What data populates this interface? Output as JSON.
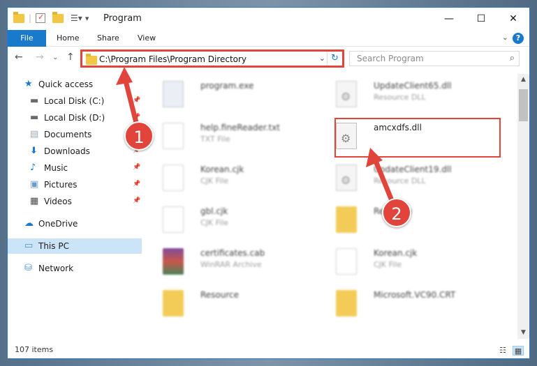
{
  "window": {
    "title": "Program",
    "controls": {
      "minimize": "—",
      "maximize": "☐",
      "close": "✕"
    }
  },
  "ribbon": {
    "tabs": [
      "File",
      "Home",
      "Share",
      "View"
    ],
    "help": "?"
  },
  "nav": {
    "address": "C:\\Program Files\\Program Directory",
    "search_placeholder": "Search Program"
  },
  "sidebar": {
    "items": [
      {
        "label": "Quick access",
        "icon": "star-icon",
        "color": "#1979ca",
        "pinned": false
      },
      {
        "label": "Local Disk (C:)",
        "icon": "drive-icon",
        "color": "#6b6b6b",
        "pinned": true
      },
      {
        "label": "Local Disk (D:)",
        "icon": "drive-icon",
        "color": "#6b6b6b",
        "pinned": true
      },
      {
        "label": "Documents",
        "icon": "documents-icon",
        "color": "#9aa8b6",
        "pinned": true
      },
      {
        "label": "Downloads",
        "icon": "download-icon",
        "color": "#1979ca",
        "pinned": true
      },
      {
        "label": "Music",
        "icon": "music-icon",
        "color": "#1979ca",
        "pinned": true
      },
      {
        "label": "Pictures",
        "icon": "pictures-icon",
        "color": "#6b9bc8",
        "pinned": true
      },
      {
        "label": "Videos",
        "icon": "videos-icon",
        "color": "#4a4a4a",
        "pinned": true
      },
      {
        "label": "OneDrive",
        "icon": "cloud-icon",
        "color": "#1979ca",
        "pinned": false
      },
      {
        "label": "This PC",
        "icon": "computer-icon",
        "color": "#4a90d9",
        "pinned": false,
        "selected": true
      },
      {
        "label": "Network",
        "icon": "network-icon",
        "color": "#4a90d9",
        "pinned": false
      }
    ]
  },
  "files": [
    {
      "name": "program.exe",
      "type": "",
      "kind": "exe",
      "blurred": true
    },
    {
      "name": "UpdateClient65.dll",
      "type": "Resource DLL",
      "kind": "dll",
      "blurred": true
    },
    {
      "name": "help.fineReader.txt",
      "type": "TXT File",
      "kind": "doc",
      "blurred": true
    },
    {
      "name": "amcxdfs.dll",
      "type": "",
      "kind": "dll",
      "blurred": false
    },
    {
      "name": "Korean.cjk",
      "type": "CJK File",
      "kind": "doc",
      "blurred": true
    },
    {
      "name": "UpdateClient19.dll",
      "type": "Resource DLL",
      "kind": "dll",
      "blurred": true
    },
    {
      "name": "gbl.cjk",
      "type": "CJK File",
      "kind": "doc",
      "blurred": true
    },
    {
      "name": "Resource",
      "type": "",
      "kind": "folder",
      "blurred": true
    },
    {
      "name": "certificates.cab",
      "type": "WinRAR Archive",
      "kind": "cab",
      "blurred": true
    },
    {
      "name": "Korean.cjk",
      "type": "CJK File",
      "kind": "doc",
      "blurred": true
    },
    {
      "name": "Resource",
      "type": "",
      "kind": "folder",
      "blurred": true
    },
    {
      "name": "Microsoft.VC90.CRT",
      "type": "",
      "kind": "folder",
      "blurred": true
    }
  ],
  "status": {
    "count": "107 items"
  },
  "annotations": {
    "step1": "1",
    "step2": "2",
    "accent": "#e0443b"
  }
}
